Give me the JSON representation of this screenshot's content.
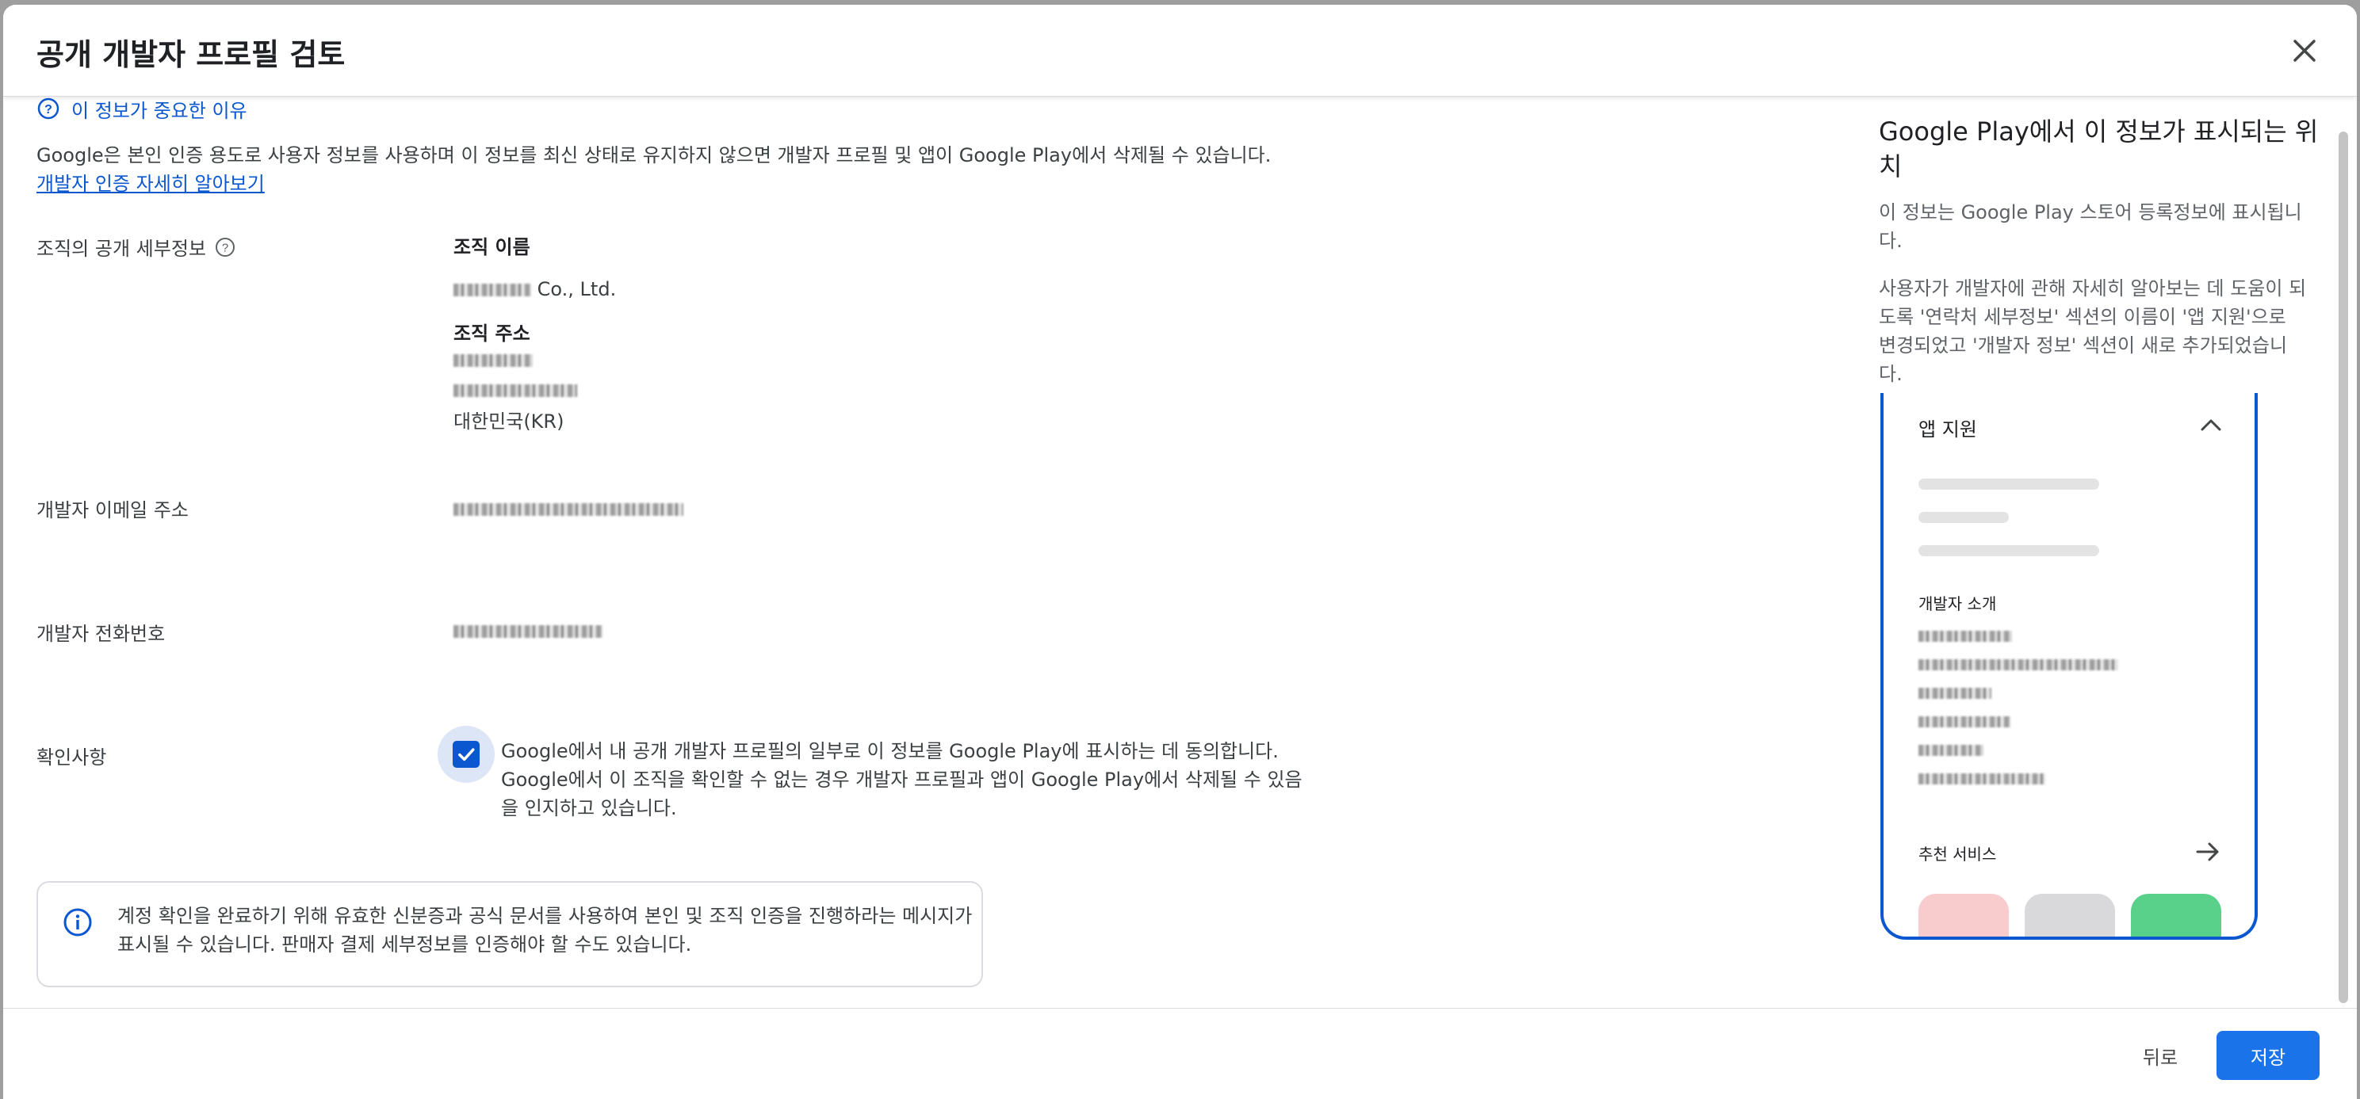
{
  "dialog": {
    "title": "공개 개발자 프로필 검토",
    "close_icon": "close-icon"
  },
  "intro": {
    "why_link": "이 정보가 중요한 이유",
    "description": "Google은 본인 인증 용도로 사용자 정보를 사용하며 이 정보를 최신 상태로 유지하지 않으면 개발자 프로필 및 앱이 Google Play에서 삭제될 수 있습니다.",
    "learn_more": "개발자 인증 자세히 알아보기"
  },
  "org_details": {
    "label": "조직의 공개 세부정보",
    "name_heading": "조직 이름",
    "name_suffix": "Co., Ltd.",
    "address_heading": "조직 주소",
    "country": "대한민국(KR)"
  },
  "email": {
    "label": "개발자 이메일 주소"
  },
  "phone": {
    "label": "개발자 전화번호"
  },
  "confirmation": {
    "label": "확인사항",
    "checked": true,
    "text": "Google에서 내 공개 개발자 프로필의 일부로 이 정보를 Google Play에 표시하는 데 동의합니다. Google에서 이 조직을 확인할 수 없는 경우 개발자 프로필과 앱이 Google Play에서 삭제될 수 있음을 인지하고 있습니다."
  },
  "info_box": {
    "text": "계정 확인을 완료하기 위해 유효한 신분증과 공식 문서를 사용하여 본인 및 조직 인증을 진행하라는 메시지가 표시될 수 있습니다. 판매자 결제 세부정보를 인증해야 할 수도 있습니다."
  },
  "right_panel": {
    "title": "Google Play에서 이 정보가 표시되는 위치",
    "para1": "이 정보는 Google Play 스토어 등록정보에 표시됩니다.",
    "para2": "사용자가 개발자에 관해 자세히 알아보는 데 도움이 되도록 '연락처 세부정보' 섹션의 이름이 '앱 지원'으로 변경되었고 '개발자 정보' 섹션이 새로 추가되었습니다.",
    "phone_mock": {
      "app_support": "앱 지원",
      "developer_about": "개발자 소개",
      "recommended": "추천 서비스",
      "tile_colors": [
        "#f8cccc",
        "#d9d9dc",
        "#5ad18a"
      ]
    }
  },
  "footer": {
    "back_label": "뒤로",
    "save_label": "저장"
  },
  "colors": {
    "accent": "#0b57d0",
    "save_button": "#1a73e8"
  }
}
